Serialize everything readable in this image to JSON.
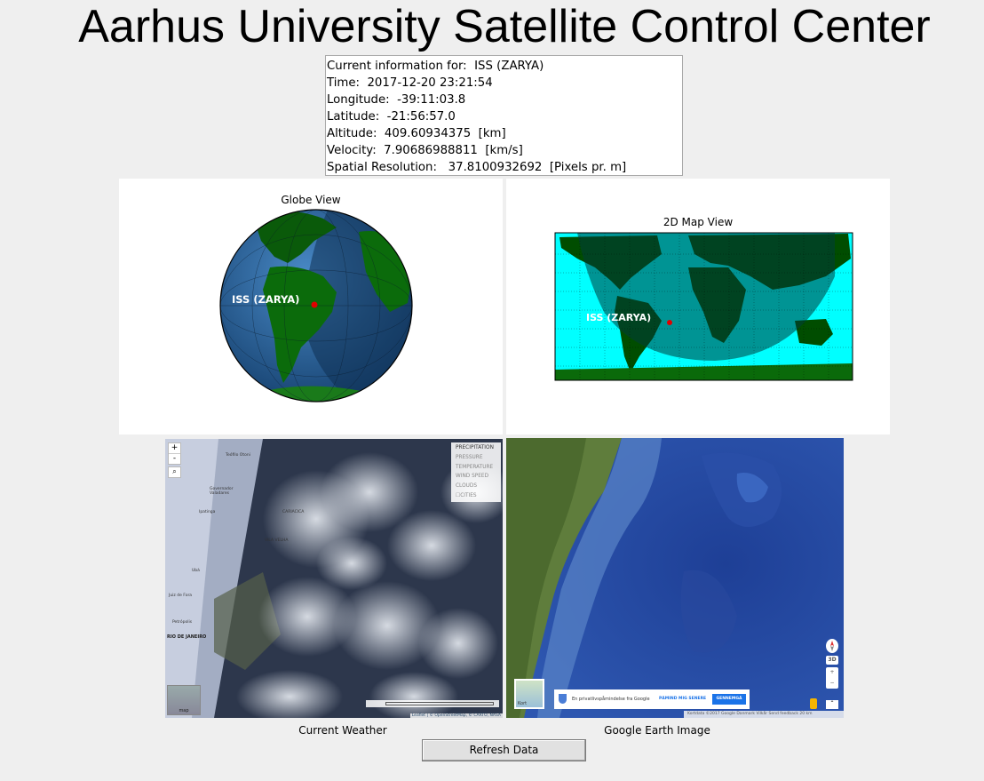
{
  "window": {
    "title": "Aarhus University Satellite Control Center"
  },
  "info": {
    "lines": [
      "Current information for:  ISS (ZARYA)",
      "Time:  2017-12-20 23:21:54",
      "Longitude:  -39:11:03.8",
      "Latitude:  -21:56:57.0",
      "Altitude:  409.60934375  [km]",
      "Velocity:  7.90686988811  [km/s]",
      "Spatial Resolution:   37.8100932692  [Pixels pr. m]"
    ]
  },
  "globe": {
    "title": "Globe View",
    "sat_label": "ISS (ZARYA)"
  },
  "map2d": {
    "title": "2D Map View",
    "sat_label": "ISS (ZARYA)"
  },
  "weather": {
    "caption": "Current Weather",
    "layers": [
      "PRECIPITATION",
      "PRESSURE",
      "TEMPERATURE",
      "WIND SPEED",
      "CLOUDS",
      "CITIES"
    ],
    "zoom_in": "+",
    "zoom_out": "-",
    "minimap_label": "map",
    "attribution": "Leaflet | © OpenStreetMap, © CARTO, NASA",
    "city_labels": [
      "Teófilo Otoni",
      "Governador Valadares",
      "Ipatinga",
      "Ubá",
      "Petrópolis",
      "Juiz de Fora",
      "RIO DE JANEIRO",
      "VILA VELHA",
      "CARIACICA"
    ]
  },
  "earth": {
    "caption": "Google Earth Image",
    "privacy_text": "En privatlivspåmindelse fra Google",
    "later_label": "PÅMIND MIG SENERE",
    "review_label": "GENNEMGÅ",
    "kort_label": "Kort",
    "footer": "Kortdata ©2017 Google  Danmark  Vilkår  Send feedback  20 km",
    "ctl_3d": "3D",
    "ctl_plus": "+",
    "ctl_minus": "−"
  },
  "actions": {
    "refresh_label": "Refresh Data"
  },
  "colors": {
    "background": "#efefef",
    "ocean_map": "#00ffff",
    "land": "#004d00",
    "night_shade": "rgba(0,60,60,0.55)",
    "sat_marker": "#e00000"
  }
}
